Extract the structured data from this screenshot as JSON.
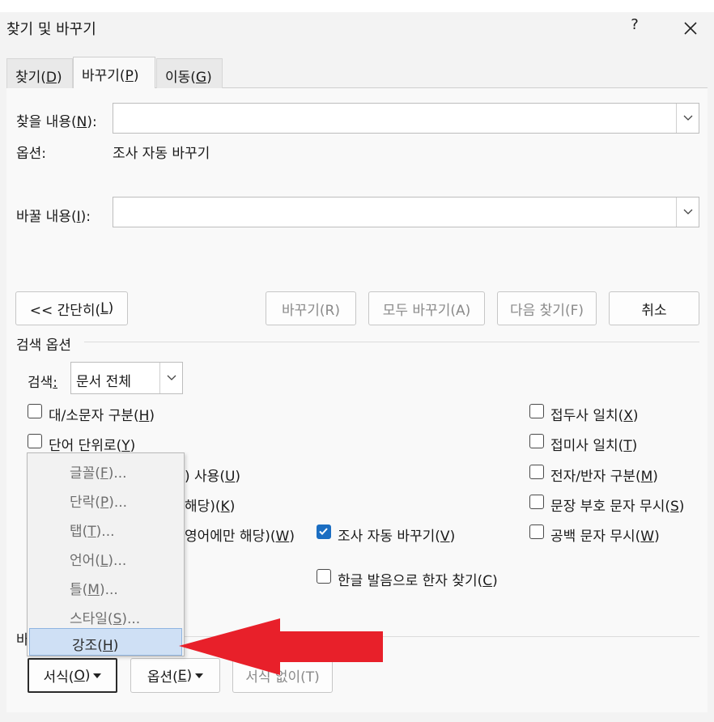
{
  "dialog": {
    "title": "찾기 및 바꾸기",
    "help": "?",
    "tabs": [
      {
        "label": "찾기(",
        "key": "D",
        "end": ")"
      },
      {
        "label": "바꾸기(",
        "key": "P",
        "end": ")"
      },
      {
        "label": "이동(",
        "key": "G",
        "end": ")"
      }
    ]
  },
  "find": {
    "label_pre": "찾을 내용(",
    "key": "N",
    "label_post": "):",
    "value": ""
  },
  "options": {
    "label": "옵션:",
    "value": "조사 자동 바꾸기"
  },
  "replace": {
    "label_pre": "바꿀 내용(",
    "key": "I",
    "label_post": "):",
    "value": ""
  },
  "buttons": {
    "less_pre": "<< 간단히(",
    "less_key": "L",
    "less_post": ")",
    "replace": "바꾸기(R)",
    "replace_all": "모두 바꾸기(A)",
    "find_next": "다음 찾기(F)",
    "cancel": "취소"
  },
  "search_options": {
    "heading": "검색 옵션",
    "search_pre": "검색",
    "search_key": ":",
    "search_value": "문서 전체"
  },
  "left_checks": [
    {
      "text": "대/소문자 구분(",
      "key": "H",
      "end": ")",
      "checked": false
    },
    {
      "text": "단어 단위로(",
      "key": "Y",
      "end": ")",
      "checked": false
    }
  ],
  "hidden_fragments": {
    "row3": ") 사용(",
    "row3_key": "U",
    "row3_end": ")",
    "row4": "해당)(",
    "row4_key": "K",
    "row4_end": ")",
    "row5": "영어에만 해당)(",
    "row5_key": "W",
    "row5_end": ")"
  },
  "mid_checks": [
    {
      "text": "조사 자동 바꾸기(",
      "key": "V",
      "end": ")",
      "checked": true
    },
    {
      "text": "한글 발음으로 한자 찾기(",
      "key": "C",
      "end": ")",
      "checked": false
    }
  ],
  "right_checks": [
    {
      "text": "접두사 일치(",
      "key": "X",
      "end": ")",
      "checked": false
    },
    {
      "text": "접미사 일치(",
      "key": "T",
      "end": ")",
      "checked": false
    },
    {
      "text": "전자/반자 구분(",
      "key": "M",
      "end": ")",
      "checked": false
    },
    {
      "text": "문장 부호 문자 무시(",
      "key": "S",
      "end": ")",
      "checked": false
    },
    {
      "text": "공백 문자 무시(",
      "key": "W",
      "end": ")",
      "checked": false
    }
  ],
  "bottom": {
    "section_partial": "바",
    "format_pre": "서식(",
    "format_key": "O",
    "format_post": ")",
    "options_pre": "옵션(",
    "options_key": "E",
    "options_post": ")",
    "no_format": "서식 없이(T)"
  },
  "format_menu": [
    {
      "pre": "글꼴(",
      "key": "F",
      "post": ")..."
    },
    {
      "pre": "단락(",
      "key": "P",
      "post": ")..."
    },
    {
      "pre": "탭(",
      "key": "T",
      "post": ")..."
    },
    {
      "pre": "언어(",
      "key": "L",
      "post": ")..."
    },
    {
      "pre": "틀(",
      "key": "M",
      "post": ")..."
    },
    {
      "pre": "스타일(",
      "key": "S",
      "post": ")..."
    },
    {
      "pre": "강조(",
      "key": "H",
      "post": ")"
    }
  ],
  "colors": {
    "accent": "#1b6ec2",
    "arrow": "#e8202a",
    "highlight": "#cfe0f5"
  }
}
